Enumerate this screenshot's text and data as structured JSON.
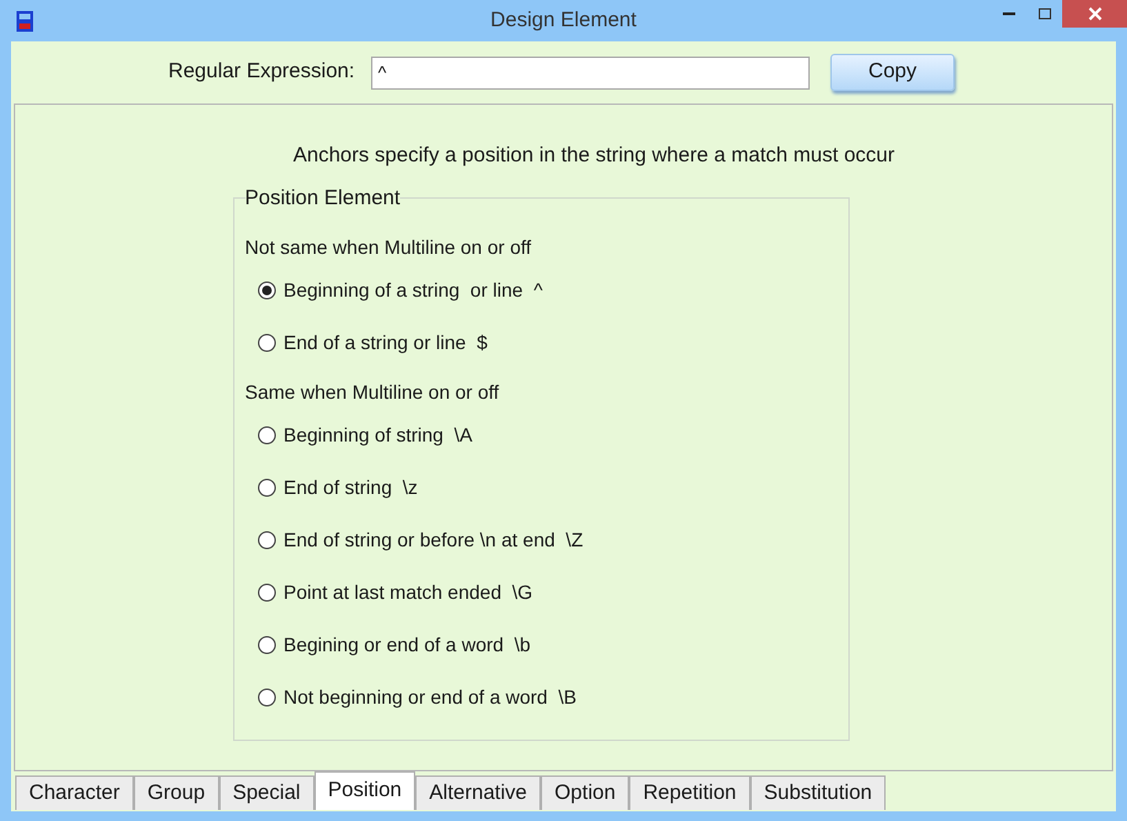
{
  "window": {
    "title": "Design Element"
  },
  "expression": {
    "label": "Regular Expression:",
    "value": "^"
  },
  "copy_button": "Copy",
  "description": "Anchors specify a position in the string where a match must occur",
  "group": {
    "title": "Position Element",
    "sections": [
      {
        "heading": "Not same when Multiline on or off",
        "options": [
          {
            "label": "Beginning of a string  or line  ^",
            "selected": true
          },
          {
            "label": "End of a string or line  $",
            "selected": false
          }
        ]
      },
      {
        "heading": "Same when Multiline on or off",
        "options": [
          {
            "label": "Beginning of string  \\A",
            "selected": false
          },
          {
            "label": "End of string  \\z",
            "selected": false
          },
          {
            "label": "End of string or before \\n at end  \\Z",
            "selected": false
          },
          {
            "label": "Point at last match ended  \\G",
            "selected": false
          },
          {
            "label": "Begining or end of a word  \\b",
            "selected": false
          },
          {
            "label": "Not beginning or end of a word  \\B",
            "selected": false
          }
        ]
      }
    ]
  },
  "tabs": [
    {
      "label": "Character",
      "selected": false
    },
    {
      "label": "Group",
      "selected": false
    },
    {
      "label": "Special",
      "selected": false
    },
    {
      "label": "Position",
      "selected": true
    },
    {
      "label": "Alternative",
      "selected": false
    },
    {
      "label": "Option",
      "selected": false
    },
    {
      "label": "Repetition",
      "selected": false
    },
    {
      "label": "Substitution",
      "selected": false
    }
  ]
}
